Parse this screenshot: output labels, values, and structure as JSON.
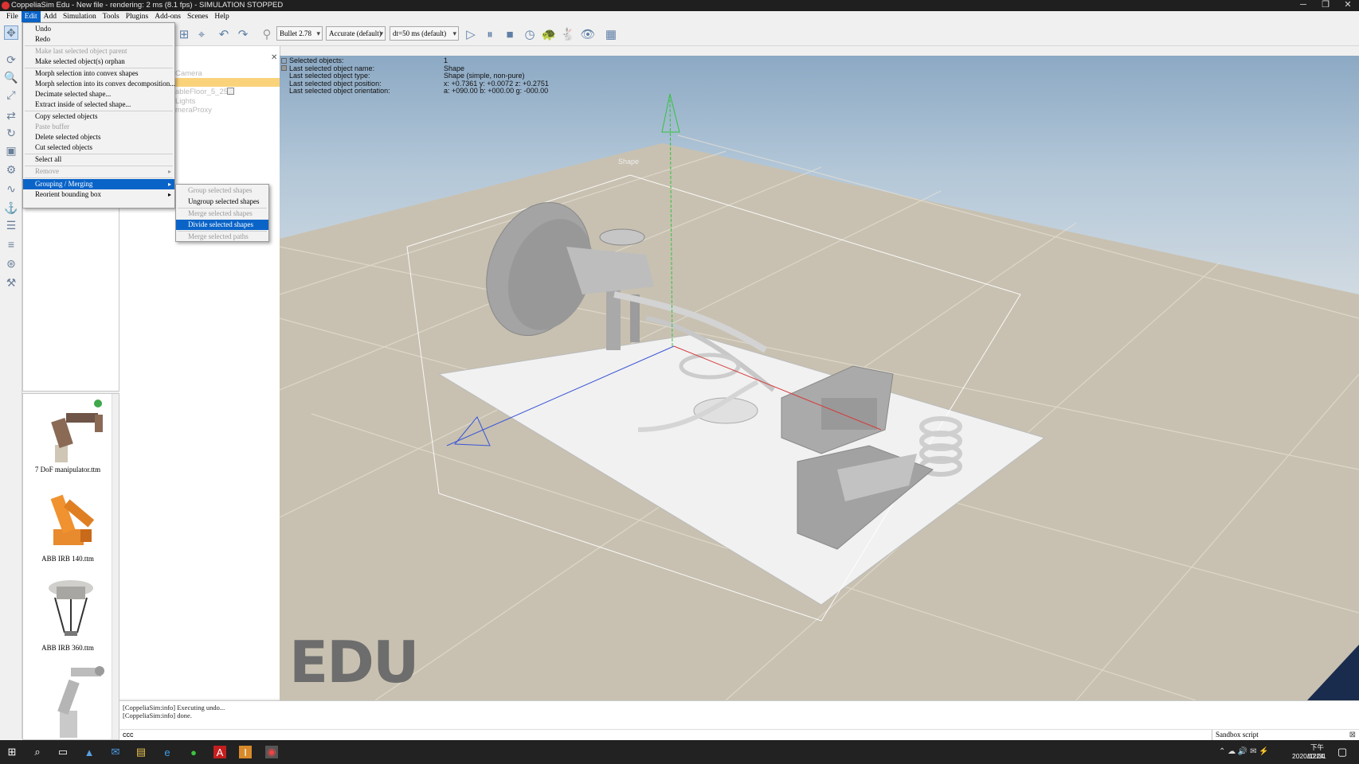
{
  "window": {
    "title": "CoppeliaSim Edu - New file - rendering: 2 ms (8.1 fps) - SIMULATION STOPPED",
    "minimize": "─",
    "restore": "❐",
    "close": "✕"
  },
  "menubar": [
    "File",
    "Edit",
    "Add",
    "Simulation",
    "Tools",
    "Plugins",
    "Add-ons",
    "Scenes",
    "Help"
  ],
  "toolbar": {
    "engine": "Bullet 2.78",
    "accuracy": "Accurate (default)",
    "timestep": "dt=50 ms (default)"
  },
  "edit_menu": {
    "items": [
      {
        "label": "Undo",
        "disabled": false
      },
      {
        "label": "Redo",
        "disabled": false
      },
      {
        "label": "Make last selected object parent",
        "disabled": true
      },
      {
        "label": "Make selected object(s) orphan",
        "disabled": false
      },
      {
        "label": "Morph selection into convex shapes",
        "disabled": false
      },
      {
        "label": "Morph selection into its convex decomposition...",
        "disabled": false
      },
      {
        "label": "Decimate selected shape...",
        "disabled": false
      },
      {
        "label": "Extract inside of selected shape...",
        "disabled": false
      },
      {
        "label": "Copy selected objects",
        "disabled": false
      },
      {
        "label": "Paste buffer",
        "disabled": true
      },
      {
        "label": "Delete selected objects",
        "disabled": false
      },
      {
        "label": "Cut selected objects",
        "disabled": false
      },
      {
        "label": "Select all",
        "disabled": false
      },
      {
        "label": "Remove",
        "disabled": true,
        "submenu": true
      },
      {
        "label": "Grouping / Merging",
        "disabled": false,
        "submenu": true,
        "selected": true
      },
      {
        "label": "Reorient bounding box",
        "disabled": false,
        "submenu": true
      }
    ]
  },
  "grouping_submenu": {
    "items": [
      {
        "label": "Group selected shapes",
        "disabled": true
      },
      {
        "label": "Ungroup selected shapes",
        "disabled": false
      },
      {
        "label": "Merge selected shapes",
        "disabled": true
      },
      {
        "label": "Divide selected shapes",
        "disabled": false,
        "selected": true
      },
      {
        "label": "Merge selected paths",
        "disabled": true
      }
    ]
  },
  "scene_hierarchy": {
    "items": [
      "Camera",
      "ableFloor_5_25",
      "Lights",
      "meraProxy"
    ]
  },
  "model_list": [
    {
      "label": "7 DoF manipulator.ttm"
    },
    {
      "label": "ABB IRB 140.ttm"
    },
    {
      "label": "ABB IRB 360.ttm"
    }
  ],
  "selection_info": {
    "rows": [
      {
        "label": "Selected objects:",
        "value": "1"
      },
      {
        "label": "Last selected object name:",
        "value": "Shape"
      },
      {
        "label": "Last selected object type:",
        "value": "Shape (simple, non-pure)"
      },
      {
        "label": "Last selected object position:",
        "value": "x: +0.7361    y: +0.0072    z: +0.2751"
      },
      {
        "label": "Last selected object orientation:",
        "value": "a: +090.00    b: +000.00    g: -000.00"
      }
    ]
  },
  "viewport": {
    "watermark": "EDU",
    "object_label": "Shape"
  },
  "console": {
    "lines": [
      "[CoppeliaSim:info] Executing undo...",
      "[CoppeliaSim:info] done."
    ]
  },
  "command": {
    "input": "ccc",
    "script": "Sandbox script"
  },
  "taskbar": {
    "time": "下午 10:24",
    "date": "2020/12/31"
  }
}
